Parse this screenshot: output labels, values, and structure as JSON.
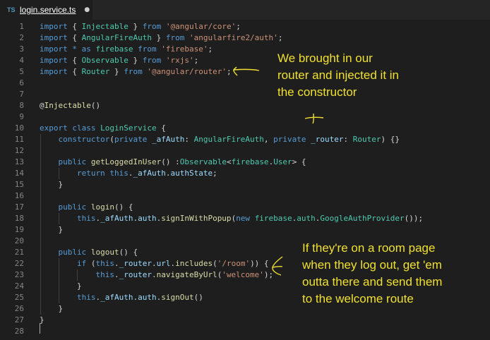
{
  "tab": {
    "icon": "TS",
    "title": "login.service.ts",
    "dirty_indicator": "●"
  },
  "lines": [
    {
      "n": "1",
      "tokens": [
        {
          "c": "k",
          "t": "import"
        },
        {
          "c": "p",
          "t": " { "
        },
        {
          "c": "t",
          "t": "Injectable"
        },
        {
          "c": "p",
          "t": " } "
        },
        {
          "c": "k",
          "t": "from"
        },
        {
          "c": "p",
          "t": " "
        },
        {
          "c": "s",
          "t": "'@angular/core'"
        },
        {
          "c": "p",
          "t": ";"
        }
      ]
    },
    {
      "n": "2",
      "tokens": [
        {
          "c": "k",
          "t": "import"
        },
        {
          "c": "p",
          "t": " { "
        },
        {
          "c": "t",
          "t": "AngularFireAuth"
        },
        {
          "c": "p",
          "t": " } "
        },
        {
          "c": "k",
          "t": "from"
        },
        {
          "c": "p",
          "t": " "
        },
        {
          "c": "s",
          "t": "'angularfire2/auth'"
        },
        {
          "c": "p",
          "t": ";"
        }
      ]
    },
    {
      "n": "3",
      "tokens": [
        {
          "c": "k",
          "t": "import"
        },
        {
          "c": "p",
          "t": " "
        },
        {
          "c": "k",
          "t": "*"
        },
        {
          "c": "p",
          "t": " "
        },
        {
          "c": "k",
          "t": "as"
        },
        {
          "c": "p",
          "t": " "
        },
        {
          "c": "t",
          "t": "firebase"
        },
        {
          "c": "p",
          "t": " "
        },
        {
          "c": "k",
          "t": "from"
        },
        {
          "c": "p",
          "t": " "
        },
        {
          "c": "s",
          "t": "'firebase'"
        },
        {
          "c": "p",
          "t": ";"
        }
      ]
    },
    {
      "n": "4",
      "tokens": [
        {
          "c": "k",
          "t": "import"
        },
        {
          "c": "p",
          "t": " { "
        },
        {
          "c": "t",
          "t": "Observable"
        },
        {
          "c": "p",
          "t": " } "
        },
        {
          "c": "k",
          "t": "from"
        },
        {
          "c": "p",
          "t": " "
        },
        {
          "c": "s",
          "t": "'rxjs'"
        },
        {
          "c": "p",
          "t": ";"
        }
      ]
    },
    {
      "n": "5",
      "tokens": [
        {
          "c": "k",
          "t": "import"
        },
        {
          "c": "p",
          "t": " { "
        },
        {
          "c": "t",
          "t": "Router"
        },
        {
          "c": "p",
          "t": " } "
        },
        {
          "c": "k",
          "t": "from"
        },
        {
          "c": "p",
          "t": " "
        },
        {
          "c": "s",
          "t": "'@angular/router'"
        },
        {
          "c": "p",
          "t": ";"
        }
      ]
    },
    {
      "n": "6",
      "tokens": []
    },
    {
      "n": "7",
      "tokens": []
    },
    {
      "n": "8",
      "tokens": [
        {
          "c": "p",
          "t": "@"
        },
        {
          "c": "f",
          "t": "Injectable"
        },
        {
          "c": "p",
          "t": "()"
        }
      ]
    },
    {
      "n": "9",
      "tokens": []
    },
    {
      "n": "10",
      "tokens": [
        {
          "c": "k",
          "t": "export"
        },
        {
          "c": "p",
          "t": " "
        },
        {
          "c": "k",
          "t": "class"
        },
        {
          "c": "p",
          "t": " "
        },
        {
          "c": "t",
          "t": "LoginService"
        },
        {
          "c": "p",
          "t": " {"
        }
      ]
    },
    {
      "n": "11",
      "tokens": [
        {
          "c": "p",
          "t": "    "
        },
        {
          "c": "k",
          "t": "constructor"
        },
        {
          "c": "p",
          "t": "("
        },
        {
          "c": "k",
          "t": "private"
        },
        {
          "c": "p",
          "t": " "
        },
        {
          "c": "v",
          "t": "_afAuth"
        },
        {
          "c": "p",
          "t": ": "
        },
        {
          "c": "t",
          "t": "AngularFireAuth"
        },
        {
          "c": "p",
          "t": ", "
        },
        {
          "c": "k",
          "t": "private"
        },
        {
          "c": "p",
          "t": " "
        },
        {
          "c": "v",
          "t": "_router"
        },
        {
          "c": "p",
          "t": ": "
        },
        {
          "c": "t",
          "t": "Router"
        },
        {
          "c": "p",
          "t": ") {}"
        }
      ]
    },
    {
      "n": "12",
      "tokens": []
    },
    {
      "n": "13",
      "tokens": [
        {
          "c": "p",
          "t": "    "
        },
        {
          "c": "k",
          "t": "public"
        },
        {
          "c": "p",
          "t": " "
        },
        {
          "c": "f",
          "t": "getLoggedInUser"
        },
        {
          "c": "p",
          "t": "() :"
        },
        {
          "c": "t",
          "t": "Observable"
        },
        {
          "c": "p",
          "t": "<"
        },
        {
          "c": "t",
          "t": "firebase"
        },
        {
          "c": "p",
          "t": "."
        },
        {
          "c": "t",
          "t": "User"
        },
        {
          "c": "p",
          "t": "> {"
        }
      ]
    },
    {
      "n": "14",
      "tokens": [
        {
          "c": "p",
          "t": "        "
        },
        {
          "c": "k",
          "t": "return"
        },
        {
          "c": "p",
          "t": " "
        },
        {
          "c": "k",
          "t": "this"
        },
        {
          "c": "p",
          "t": "."
        },
        {
          "c": "v",
          "t": "_afAuth"
        },
        {
          "c": "p",
          "t": "."
        },
        {
          "c": "v",
          "t": "authState"
        },
        {
          "c": "p",
          "t": ";"
        }
      ]
    },
    {
      "n": "15",
      "tokens": [
        {
          "c": "p",
          "t": "    }"
        }
      ]
    },
    {
      "n": "16",
      "tokens": []
    },
    {
      "n": "17",
      "tokens": [
        {
          "c": "p",
          "t": "    "
        },
        {
          "c": "k",
          "t": "public"
        },
        {
          "c": "p",
          "t": " "
        },
        {
          "c": "f",
          "t": "login"
        },
        {
          "c": "p",
          "t": "() {"
        }
      ]
    },
    {
      "n": "18",
      "tokens": [
        {
          "c": "p",
          "t": "        "
        },
        {
          "c": "k",
          "t": "this"
        },
        {
          "c": "p",
          "t": "."
        },
        {
          "c": "v",
          "t": "_afAuth"
        },
        {
          "c": "p",
          "t": "."
        },
        {
          "c": "v",
          "t": "auth"
        },
        {
          "c": "p",
          "t": "."
        },
        {
          "c": "f",
          "t": "signInWithPopup"
        },
        {
          "c": "p",
          "t": "("
        },
        {
          "c": "k",
          "t": "new"
        },
        {
          "c": "p",
          "t": " "
        },
        {
          "c": "t",
          "t": "firebase"
        },
        {
          "c": "p",
          "t": "."
        },
        {
          "c": "t",
          "t": "auth"
        },
        {
          "c": "p",
          "t": "."
        },
        {
          "c": "t",
          "t": "GoogleAuthProvider"
        },
        {
          "c": "p",
          "t": "());"
        }
      ]
    },
    {
      "n": "19",
      "tokens": [
        {
          "c": "p",
          "t": "    }"
        }
      ]
    },
    {
      "n": "20",
      "tokens": []
    },
    {
      "n": "21",
      "tokens": [
        {
          "c": "p",
          "t": "    "
        },
        {
          "c": "k",
          "t": "public"
        },
        {
          "c": "p",
          "t": " "
        },
        {
          "c": "f",
          "t": "logout"
        },
        {
          "c": "p",
          "t": "() {"
        }
      ]
    },
    {
      "n": "22",
      "tokens": [
        {
          "c": "p",
          "t": "        "
        },
        {
          "c": "k",
          "t": "if"
        },
        {
          "c": "p",
          "t": " ("
        },
        {
          "c": "k",
          "t": "this"
        },
        {
          "c": "p",
          "t": "."
        },
        {
          "c": "v",
          "t": "_router"
        },
        {
          "c": "p",
          "t": "."
        },
        {
          "c": "v",
          "t": "url"
        },
        {
          "c": "p",
          "t": "."
        },
        {
          "c": "f",
          "t": "includes"
        },
        {
          "c": "p",
          "t": "("
        },
        {
          "c": "s",
          "t": "'/room'"
        },
        {
          "c": "p",
          "t": ")) {"
        }
      ]
    },
    {
      "n": "23",
      "tokens": [
        {
          "c": "p",
          "t": "            "
        },
        {
          "c": "k",
          "t": "this"
        },
        {
          "c": "p",
          "t": "."
        },
        {
          "c": "v",
          "t": "_router"
        },
        {
          "c": "p",
          "t": "."
        },
        {
          "c": "f",
          "t": "navigateByUrl"
        },
        {
          "c": "p",
          "t": "("
        },
        {
          "c": "s",
          "t": "'welcome'"
        },
        {
          "c": "p",
          "t": ");"
        }
      ]
    },
    {
      "n": "24",
      "tokens": [
        {
          "c": "p",
          "t": "        }"
        }
      ]
    },
    {
      "n": "25",
      "tokens": [
        {
          "c": "p",
          "t": "        "
        },
        {
          "c": "k",
          "t": "this"
        },
        {
          "c": "p",
          "t": "."
        },
        {
          "c": "v",
          "t": "_afAuth"
        },
        {
          "c": "p",
          "t": "."
        },
        {
          "c": "v",
          "t": "auth"
        },
        {
          "c": "p",
          "t": "."
        },
        {
          "c": "f",
          "t": "signOut"
        },
        {
          "c": "p",
          "t": "()"
        }
      ]
    },
    {
      "n": "26",
      "tokens": [
        {
          "c": "p",
          "t": "    }"
        }
      ]
    },
    {
      "n": "27",
      "tokens": [
        {
          "c": "p",
          "t": "}"
        }
      ]
    },
    {
      "n": "28",
      "tokens": []
    }
  ],
  "annotations": {
    "note_router": [
      "We brought in our",
      "router and injected it in",
      "the constructor"
    ],
    "note_logout": [
      "If they're on a room page",
      "when they log out, get 'em",
      "outta there and send them",
      "to the welcome route"
    ]
  },
  "colors": {
    "background": "#1e1e1e",
    "keyword": "#569cd6",
    "string": "#ce9178",
    "type": "#4ec9b0",
    "function": "#dcdcaa",
    "variable": "#9cdcfe",
    "annotation": "#f0e030"
  }
}
